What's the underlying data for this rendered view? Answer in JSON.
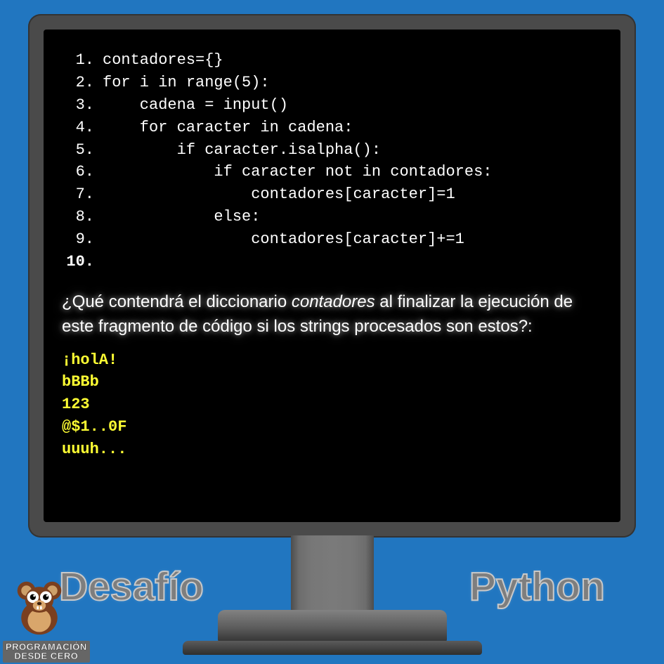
{
  "code": {
    "lines": [
      {
        "n": "1.",
        "text": "contadores={}"
      },
      {
        "n": "2.",
        "text": "for i in range(5):"
      },
      {
        "n": "3.",
        "text": "    cadena = input()"
      },
      {
        "n": "4.",
        "text": "    for caracter in cadena:"
      },
      {
        "n": "5.",
        "text": "        if caracter.isalpha():"
      },
      {
        "n": "6.",
        "text": "            if caracter not in contadores:"
      },
      {
        "n": "7.",
        "text": "                contadores[caracter]=1"
      },
      {
        "n": "8.",
        "text": "            else:"
      },
      {
        "n": "9.",
        "text": "                contadores[caracter]+=1"
      },
      {
        "n": "10.",
        "text": ""
      }
    ]
  },
  "question": {
    "part1": "¿Qué contendrá el diccionario ",
    "italic": "contadores",
    "part2": " al finalizar la ejecución de este fragmento de código si los strings procesados son estos?:"
  },
  "inputs": [
    "¡holA!",
    "bBBb",
    "123",
    "@$1..0F",
    "uuuh..."
  ],
  "titles": {
    "left": "Desafío",
    "right": "Python"
  },
  "brand": {
    "line1": "PROGRAMACIÓN",
    "line2": "DESDE CERO"
  }
}
